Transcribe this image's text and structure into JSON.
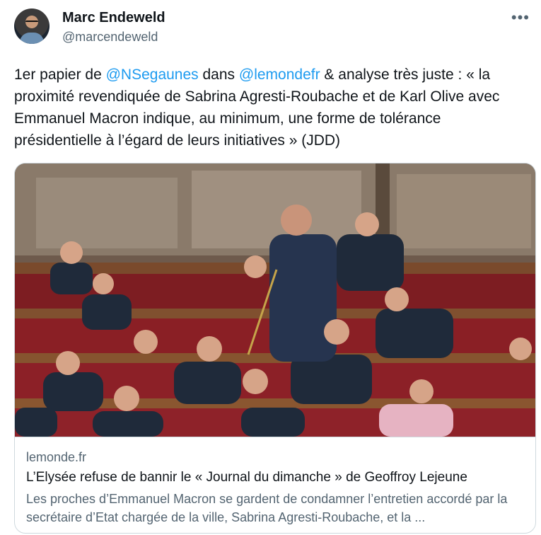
{
  "author": {
    "name": "Marc Endeweld",
    "handle": "@marcendeweld",
    "more_icon": "ellipsis-icon"
  },
  "tweet": {
    "t1": "1er papier de ",
    "mention1": "@NSegaunes",
    "t2": " dans ",
    "mention2": "@lemondefr",
    "t3": " & analyse très juste : « la proximité revendiquée de Sabrina Agresti-Roubache et de Karl Olive avec Emmanuel Macron indique, au minimum, une forme de tolérance présidentielle à l’égard de leurs initiatives » (JDD)"
  },
  "card": {
    "domain": "lemonde.fr",
    "title": "L’Elysée refuse de bannir le « Journal du dimanche » de Geoffroy Lejeune",
    "description": "Les proches d’Emmanuel Macron se gardent de condamner l’entretien accordé par la secrétaire d’Etat chargée de la ville, Sabrina Agresti-Roubache, et la ..."
  },
  "colors": {
    "link": "#1d9bf0",
    "text": "#0f1419",
    "secondary": "#536471",
    "border": "#cfd9de"
  }
}
